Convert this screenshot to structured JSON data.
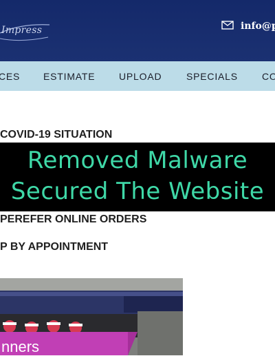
{
  "header": {
    "logo_text": "Impress",
    "contact_email": "info@p"
  },
  "nav": {
    "items": [
      "CES",
      "ESTIMATE",
      "UPLOAD",
      "SPECIALS",
      "CO"
    ]
  },
  "notices": {
    "covid": "COVID-19 SITUATION",
    "orders": "PEREFER ONLINE ORDERS",
    "appointment": "P BY APPOINTMENT"
  },
  "overlay": {
    "line1": "Removed Malware",
    "line2": "Secured The Website",
    "text_color": "#3fd8a7",
    "background": "#000000"
  },
  "promo": {
    "label": "nners"
  },
  "colors": {
    "header_bg": "#14296a",
    "nav_bg": "#bcdce8",
    "promo_label_bg": "#c13fb5"
  }
}
